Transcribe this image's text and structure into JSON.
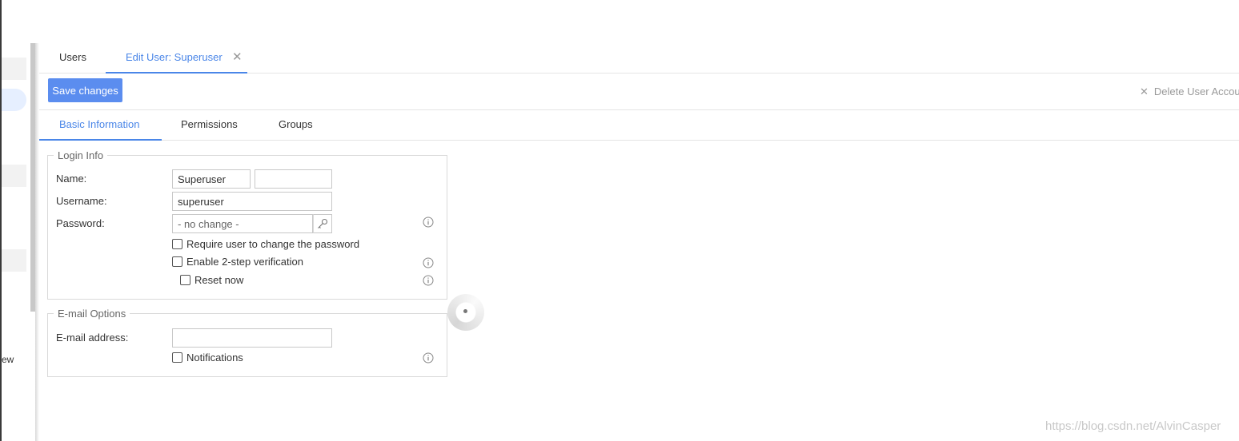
{
  "sidebar": {
    "partial_label": "ew"
  },
  "top_tabs": [
    {
      "label": "Users"
    },
    {
      "label": "Edit User: Superuser"
    }
  ],
  "toolbar": {
    "save_label": "Save changes",
    "delete_label": "Delete User Accou"
  },
  "sub_tabs": [
    {
      "label": "Basic Information"
    },
    {
      "label": "Permissions"
    },
    {
      "label": "Groups"
    }
  ],
  "login_info": {
    "legend": "Login Info",
    "name_label": "Name:",
    "first_name_value": "Superuser",
    "last_name_value": "",
    "username_label": "Username:",
    "username_value": "superuser",
    "password_label": "Password:",
    "password_placeholder": "- no change -",
    "require_change_label": "Require user to change the password",
    "two_step_label": "Enable 2-step verification",
    "reset_now_label": "Reset now"
  },
  "email_options": {
    "legend": "E-mail Options",
    "email_label": "E-mail address:",
    "email_value": "",
    "notifications_label": "Notifications"
  },
  "watermark": "https://blog.csdn.net/AlvinCasper",
  "colors": {
    "accent": "#4a86e8",
    "button": "#5b8def"
  }
}
